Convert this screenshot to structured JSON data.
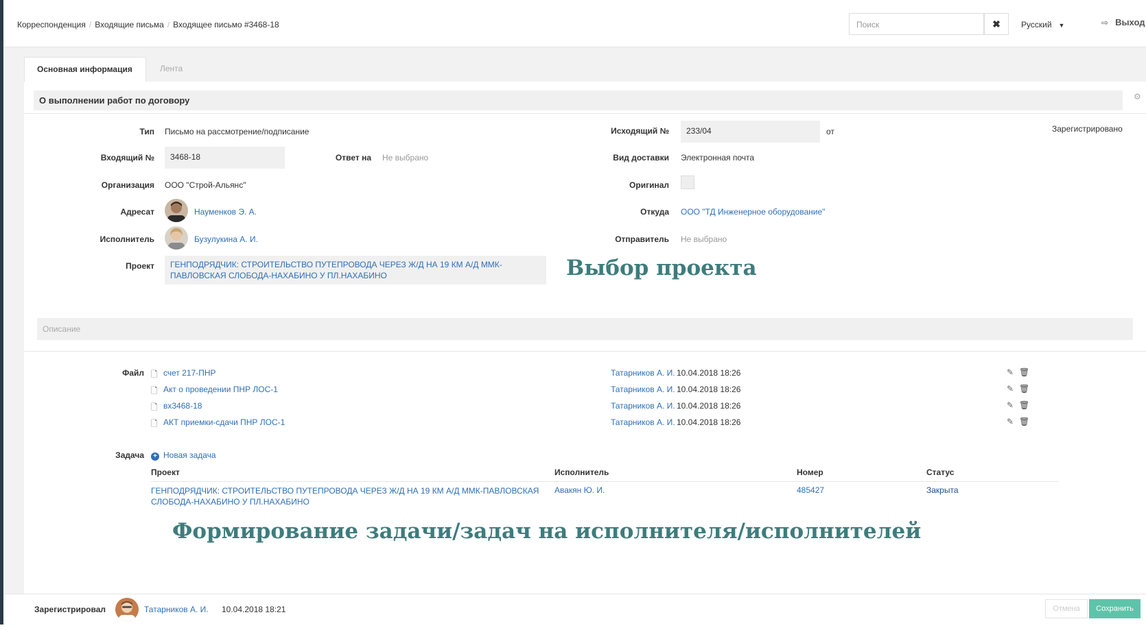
{
  "breadcrumb": {
    "items": [
      "Корреспонденция",
      "Входящие письма",
      "Входящее письмо #3468-18"
    ],
    "separator": "/"
  },
  "header": {
    "search_placeholder": "Поиск",
    "search_clear_icon": "close-icon",
    "language": "Русский",
    "logout_label": "Выход"
  },
  "tabs": [
    {
      "label": "Основная информация",
      "active": true
    },
    {
      "label": "Лента",
      "active": false
    }
  ],
  "subject": "О выполнении работ по договору",
  "fields": {
    "type_label": "Тип",
    "type_value": "Письмо на рассмотрение/подписание",
    "outgoing_label": "Исходящий №",
    "outgoing_value": "233/04",
    "outgoing_from": "от",
    "status": "Зарегистрировано",
    "incoming_label": "Входящий №",
    "incoming_value": "3468-18",
    "reply_label": "Ответ на",
    "reply_value": "Не выбрано",
    "delivery_label": "Вид доставки",
    "delivery_value": "Электронная почта",
    "org_label": "Организация",
    "org_value": "ООО \"Строй-Альянс\"",
    "original_label": "Оригинал",
    "addressee_label": "Адресат",
    "addressee_value": "Науменков Э. А.",
    "from_label": "Откуда",
    "from_value": "ООО \"ТД Инженерное оборудование\"",
    "executor_label": "Исполнитель",
    "executor_value": "Бузулукина А. И.",
    "sender_label": "Отправитель",
    "sender_value": "Не выбрано",
    "project_label": "Проект",
    "project_value": "ГЕНПОДРЯДЧИК: СТРОИТЕЛЬСТВО ПУТЕПРОВОДА ЧЕРЕЗ Ж/Д НА 19 КМ А/Д ММК-ПАВЛОВСКАЯ СЛОБОДА-НАХАБИНО У ПЛ.НАХАБИНО",
    "description_placeholder": "Описание"
  },
  "annotations": {
    "project_choice": "Выбор проекта",
    "task_forming": "Формирование задачи/задач на исполнителя/исполнителей"
  },
  "files": {
    "label": "Файл",
    "items": [
      {
        "name": "счет 217-ПНР",
        "user": "Татарников А. И.",
        "date": "10.04.2018 18:26"
      },
      {
        "name": "Акт о проведении ПНР ЛОС-1",
        "user": "Татарников А. И.",
        "date": "10.04.2018 18:26"
      },
      {
        "name": "вх3468-18",
        "user": "Татарников А. И.",
        "date": "10.04.2018 18:26"
      },
      {
        "name": "АКТ приемки-сдачи ПНР ЛОС-1",
        "user": "Татарников А. И.",
        "date": "10.04.2018 18:26"
      }
    ]
  },
  "tasks": {
    "label": "Задача",
    "new_task": "Новая задача",
    "columns": [
      "Проект",
      "Исполнитель",
      "Номер",
      "Статус"
    ],
    "rows": [
      {
        "project": "ГЕНПОДРЯДЧИК: СТРОИТЕЛЬСТВО ПУТЕПРОВОДА ЧЕРЕЗ Ж/Д НА 19 КМ А/Д ММК-ПАВЛОВСКАЯ СЛОБОДА-НАХАБИНО У ПЛ.НАХАБИНО",
        "executor": "Авакян Ю. И.",
        "number": "485427",
        "status": "Закрыта"
      }
    ]
  },
  "footer": {
    "registered_label": "Зарегистрировал",
    "registered_user": "Татарников А. И.",
    "registered_date": "10.04.2018 18:21",
    "cancel_label": "Отмена",
    "save_label": "Сохранить"
  },
  "colors": {
    "accent": "#2f6fb6",
    "save_button": "#5ec4a9",
    "annotation": "#3e7c7c"
  }
}
